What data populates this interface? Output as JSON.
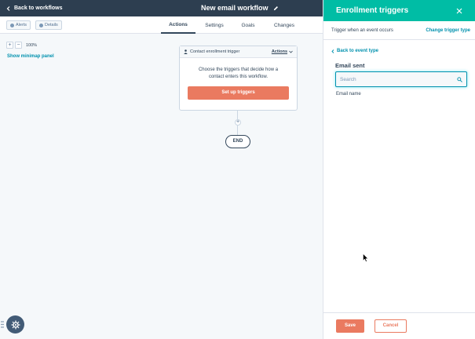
{
  "header": {
    "back_label": "Back to workflows",
    "workflow_title": "New email workflow"
  },
  "toolbar": {
    "alerts_label": "Alerts",
    "details_label": "Details",
    "tabs": [
      {
        "label": "Actions",
        "active": true
      },
      {
        "label": "Settings",
        "active": false
      },
      {
        "label": "Goals",
        "active": false
      },
      {
        "label": "Changes",
        "active": false
      }
    ]
  },
  "canvas": {
    "zoom_in": "+",
    "zoom_out": "−",
    "zoom_level": "100%",
    "minimap_label": "Show minimap panel",
    "trigger_card": {
      "title": "Contact enrollment trigger",
      "actions_label": "Actions",
      "body": "Choose the triggers that decide how a contact enters this workflow.",
      "button_label": "Set up triggers"
    },
    "add_label": "+",
    "end_label": "END"
  },
  "panel": {
    "title": "Enrollment triggers",
    "subtitle": "Trigger when an event occurs",
    "change_label": "Change trigger type",
    "back_label": "Back to event type",
    "section_title": "Email sent",
    "search_placeholder": "Search",
    "search_value": "",
    "properties": [
      "Email name"
    ],
    "save_label": "Save",
    "cancel_label": "Cancel"
  },
  "colors": {
    "header_dark": "#2d3e50",
    "panel_header": "#00bda5",
    "primary_button": "#ea7a60",
    "link": "#0091ae"
  },
  "icons": {
    "back": "chevron-left-icon",
    "edit": "pencil-icon",
    "close": "close-icon",
    "search": "search-icon",
    "person": "person-icon",
    "help": "help-widget-icon"
  }
}
